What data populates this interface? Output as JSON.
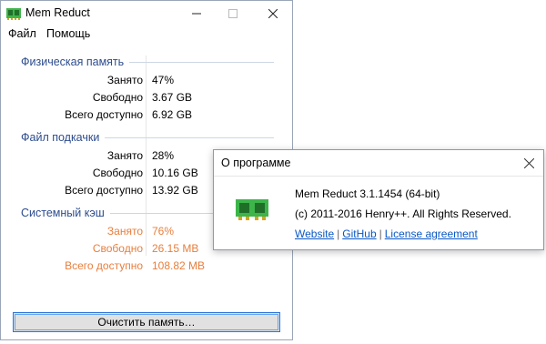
{
  "main_window": {
    "title": "Mem Reduct",
    "menu": [
      "Файл",
      "Помощь"
    ]
  },
  "groups": {
    "physical": {
      "title": "Физическая память",
      "rows": [
        {
          "label": "Занято",
          "value": "47%"
        },
        {
          "label": "Свободно",
          "value": "3.67 GB"
        },
        {
          "label": "Всего доступно",
          "value": "6.92 GB"
        }
      ]
    },
    "pagefile": {
      "title": "Файл подкачки",
      "rows": [
        {
          "label": "Занято",
          "value": "28%"
        },
        {
          "label": "Свободно",
          "value": "10.16 GB"
        },
        {
          "label": "Всего доступно",
          "value": "13.92 GB"
        }
      ]
    },
    "cache": {
      "title": "Системный кэш",
      "rows": [
        {
          "label": "Занято",
          "value": "76%"
        },
        {
          "label": "Свободно",
          "value": "26.15 MB"
        },
        {
          "label": "Всего доступно",
          "value": "108.82 MB"
        }
      ]
    }
  },
  "clean_button": "Очистить память…",
  "about_dialog": {
    "title": "О программе",
    "version": "Mem Reduct 3.1.1454 (64-bit)",
    "copyright": "(c) 2011-2016 Henry++. All Rights Reserved.",
    "links": {
      "website": "Website",
      "github": "GitHub",
      "license": "License agreement"
    },
    "separator": "|"
  },
  "colors": {
    "group_title": "#2d4c8e",
    "cache_text": "#e87e3c",
    "link": "#0a58c4",
    "button_border": "#2b74d6",
    "icon_green": "#3db54a"
  },
  "icons": {
    "app": "memory-chip-icon",
    "minimize": "minimize-icon",
    "maximize": "maximize-icon",
    "close": "close-icon"
  }
}
